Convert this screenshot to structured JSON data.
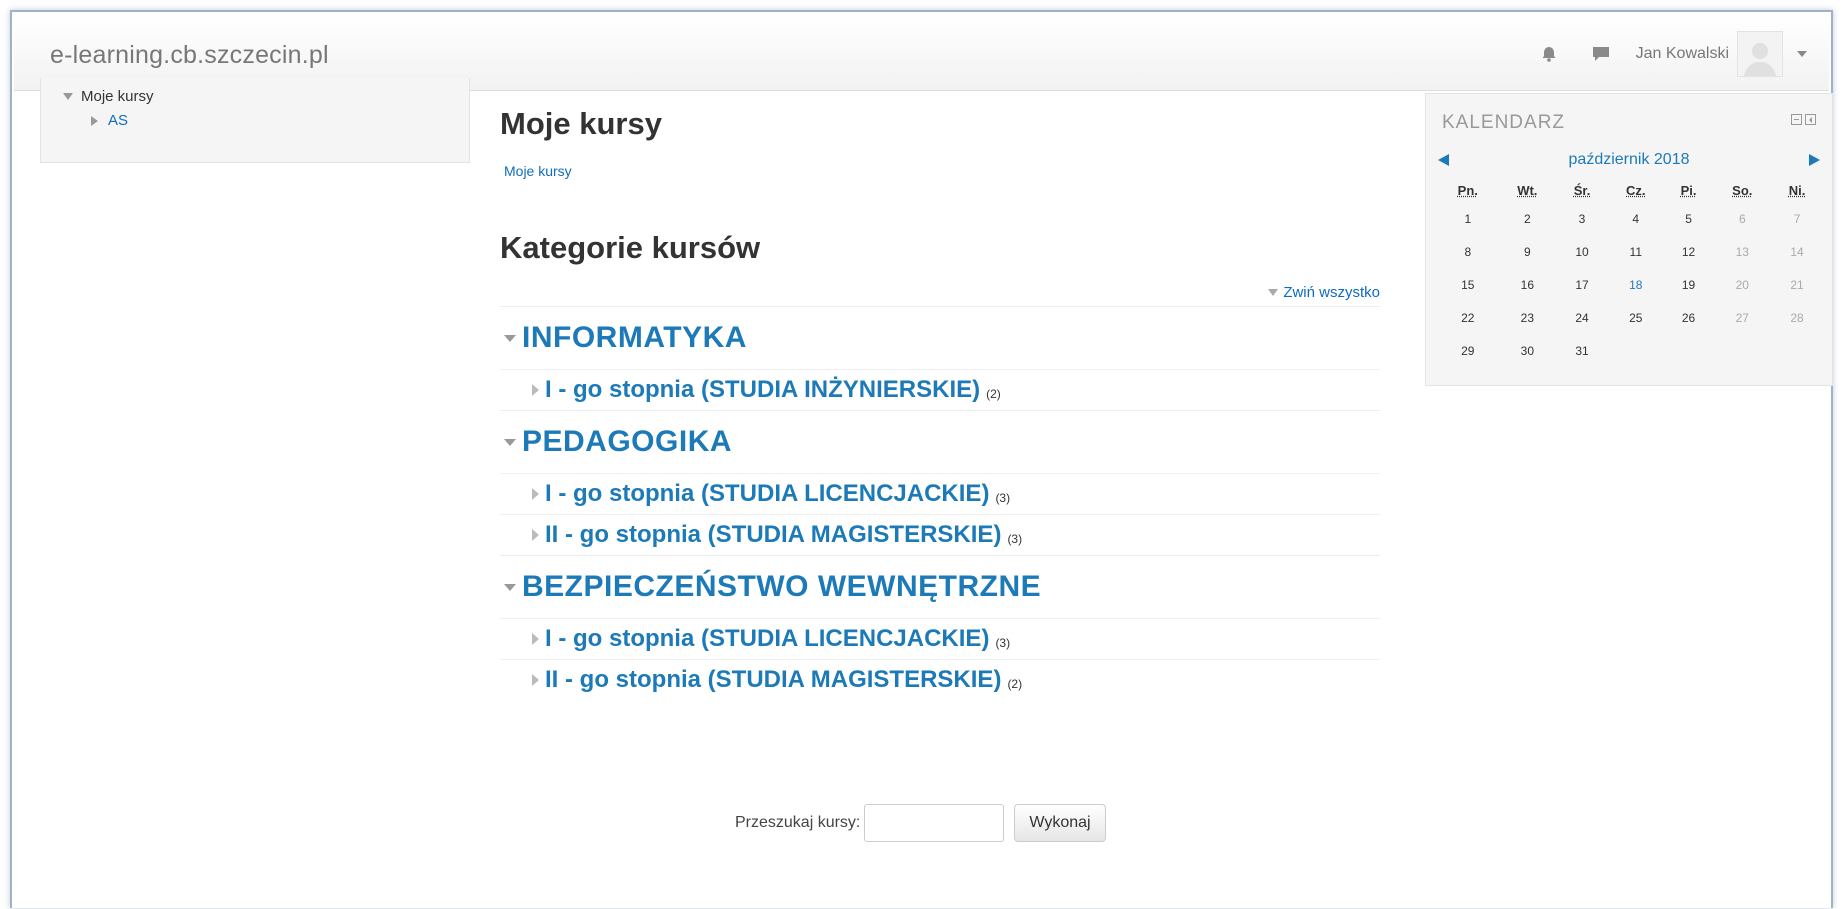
{
  "navbar": {
    "brand": "e-learning.cb.szczecin.pl",
    "user_name": "Jan Kowalski",
    "icons": [
      "notifications-bell-icon",
      "messages-chat-icon"
    ]
  },
  "left_block": {
    "root_label": "Moje kursy",
    "child_label": "AS"
  },
  "main": {
    "title": "Moje kursy",
    "breadcrumb": "Moje kursy",
    "categories_title": "Kategorie kursów",
    "collapse_all": "Zwiń wszystko",
    "categories": [
      {
        "name": "INFORMATYKA",
        "subs": [
          {
            "name": "I - go stopnia (STUDIA INŻYNIERSKIE)",
            "count": "(2)"
          }
        ]
      },
      {
        "name": "PEDAGOGIKA",
        "subs": [
          {
            "name": "I - go stopnia (STUDIA LICENCJACKIE)",
            "count": "(3)"
          },
          {
            "name": "II - go stopnia (STUDIA MAGISTERSKIE)",
            "count": "(3)"
          }
        ]
      },
      {
        "name": "BEZPIECZEŃSTWO WEWNĘTRZNE",
        "subs": [
          {
            "name": "I - go stopnia (STUDIA LICENCJACKIE)",
            "count": "(3)"
          },
          {
            "name": "II - go stopnia (STUDIA MAGISTERSKIE)",
            "count": "(2)"
          }
        ]
      }
    ],
    "search_label": "Przeszukaj kursy:",
    "search_value": "",
    "search_button": "Wykonaj"
  },
  "calendar": {
    "title": "KALENDARZ",
    "month": "październik 2018",
    "weekdays": [
      "Pn.",
      "Wt.",
      "Śr.",
      "Cz.",
      "Pi.",
      "So.",
      "Ni."
    ],
    "weeks": [
      [
        "1",
        "2",
        "3",
        "4",
        "5",
        "6",
        "7"
      ],
      [
        "8",
        "9",
        "10",
        "11",
        "12",
        "13",
        "14"
      ],
      [
        "15",
        "16",
        "17",
        "18",
        "19",
        "20",
        "21"
      ],
      [
        "22",
        "23",
        "24",
        "25",
        "26",
        "27",
        "28"
      ],
      [
        "29",
        "30",
        "31",
        "",
        "",
        "",
        ""
      ]
    ],
    "today": "18",
    "colors": {
      "link": "#1d7ab8",
      "weekend": "#aaaaaa"
    }
  }
}
